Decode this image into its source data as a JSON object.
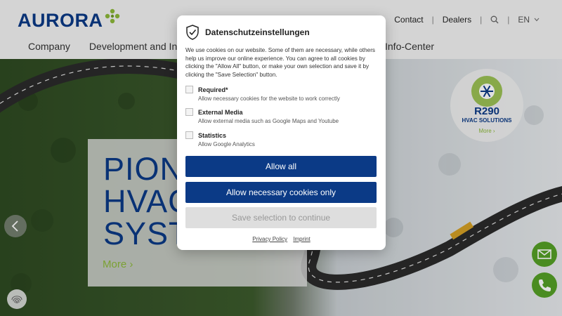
{
  "brand": {
    "name": "AURORA",
    "primary_color": "#0b3a86",
    "accent_color": "#8cb83a"
  },
  "util_nav": {
    "contact": "Contact",
    "dealers": "Dealers",
    "search_icon": "search-icon",
    "language": "EN"
  },
  "main_nav": {
    "company": "Company",
    "development": "Development and Inno",
    "info_center": "Info-Center"
  },
  "hero": {
    "title": "PIONI\nHVAC\nSYST",
    "more": "More",
    "badge": {
      "name": "R290",
      "sub": "HVAC SOLUTIONS",
      "more": "More"
    }
  },
  "cookie_modal": {
    "title": "Datenschutzeinstellungen",
    "intro": "We use cookies on our website. Some of them are necessary, while others help us improve our online experience. You can agree to all cookies by clicking the \"Allow All\" button, or make your own selection and save it by clicking the \"Save Selection\" button.",
    "options": [
      {
        "name": "Required*",
        "desc": "Allow necessary cookies for the website to work correctly"
      },
      {
        "name": "External Media",
        "desc": "Allow external media such as Google Maps and Youtube"
      },
      {
        "name": "Statistics",
        "desc": "Allow Google Analytics"
      }
    ],
    "allow_all": "Allow all",
    "allow_necessary": "Allow necessary cookies only",
    "save_selection": "Save selection to continue",
    "privacy_policy": "Privacy Policy",
    "imprint": "Imprint"
  }
}
